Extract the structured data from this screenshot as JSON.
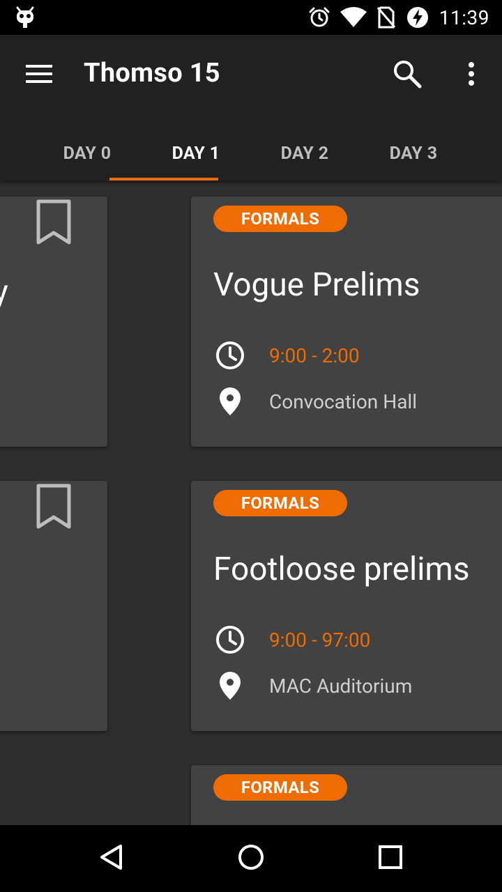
{
  "status_bar": {
    "time": "11:39",
    "icons": [
      "cyanogen-bug-icon",
      "alarm-icon",
      "wifi-icon",
      "no-sim-icon",
      "battery-charging-icon"
    ]
  },
  "app_bar": {
    "title": "Thomso 15",
    "icons": [
      "menu-icon",
      "search-icon",
      "more-vert-icon"
    ]
  },
  "tabs": [
    {
      "label": "DAY 0",
      "active": false
    },
    {
      "label": "DAY 1",
      "active": true
    },
    {
      "label": "DAY 2",
      "active": false
    },
    {
      "label": "DAY 3",
      "active": false
    }
  ],
  "left_column": {
    "cards": [
      {
        "partial_text": "y",
        "icon": "bookmark-icon"
      },
      {
        "partial_text": "",
        "icon": "bookmark-icon"
      }
    ]
  },
  "events": [
    {
      "category": "FORMALS",
      "title": "Vogue Prelims",
      "time": "9:00 - 2:00",
      "venue": "Convocation Hall"
    },
    {
      "category": "FORMALS",
      "title": "Footloose prelims",
      "time": "9:00 - 97:00",
      "venue": "MAC Auditorium"
    },
    {
      "category": "FORMALS",
      "title": "",
      "time": "",
      "venue": ""
    }
  ],
  "nav_bar": {
    "icons": [
      "back-icon",
      "home-icon",
      "recents-icon"
    ]
  },
  "colors": {
    "accent": "#ef6c00",
    "app_bar": "#212121",
    "card": "#424242",
    "background": "#2d2d2d",
    "venue_text": "#cfcfcf"
  }
}
